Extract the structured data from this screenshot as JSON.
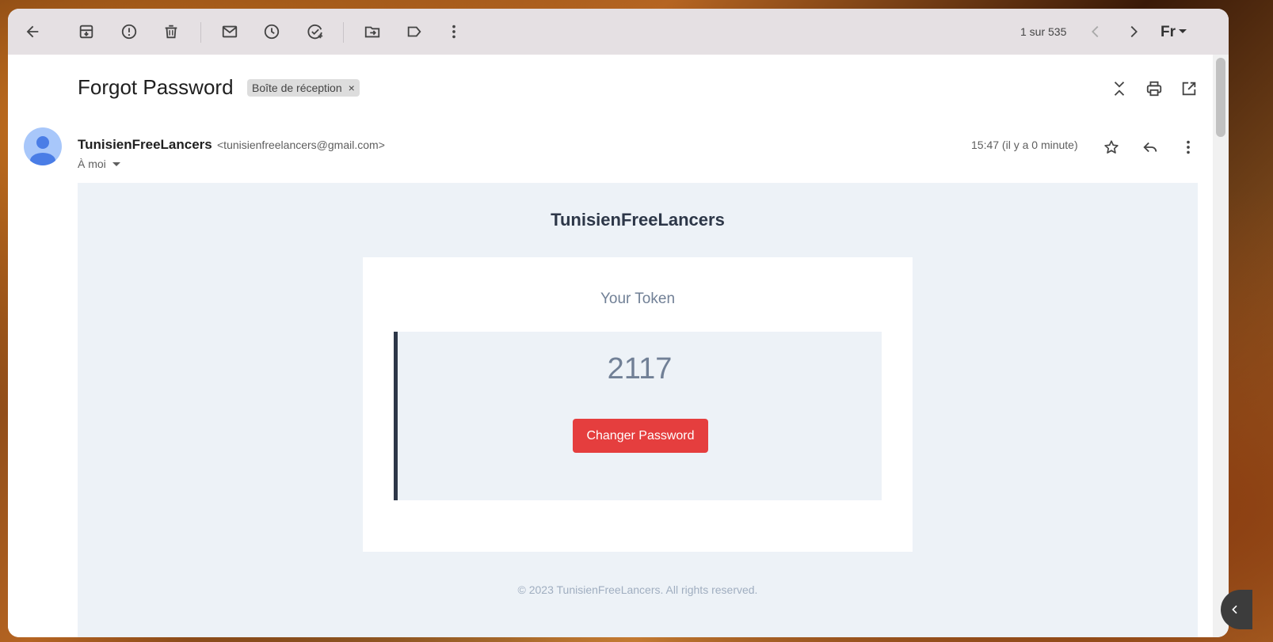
{
  "toolbar": {
    "counter": "1 sur 535",
    "input_tool": "Fr",
    "icons": [
      "back-arrow-icon",
      "archive-icon",
      "report-spam-icon",
      "delete-icon",
      "mark-unread-icon",
      "snooze-icon",
      "add-task-icon",
      "move-to-icon",
      "label-icon",
      "more-vert-icon",
      "prev-icon",
      "next-icon"
    ]
  },
  "header": {
    "subject": "Forgot Password",
    "label_chip": "Boîte de réception",
    "label_remove": "×"
  },
  "message": {
    "sender_name": "TunisienFreeLancers",
    "sender_email": "<tunisienfreelancers@gmail.com>",
    "to": "À moi",
    "timestamp": "15:47 (il y a 0 minute)"
  },
  "email": {
    "brand": "TunisienFreeLancers",
    "card_title": "Your Token",
    "token": "2117",
    "button_label": "Changer Password",
    "footer": "© 2023 TunisienFreeLancers. All rights reserved."
  },
  "colors": {
    "button": "#e53e3e",
    "body_bg": "#edf2f7",
    "accent_border": "#2d3748",
    "avatar": "#a8c7fa"
  }
}
